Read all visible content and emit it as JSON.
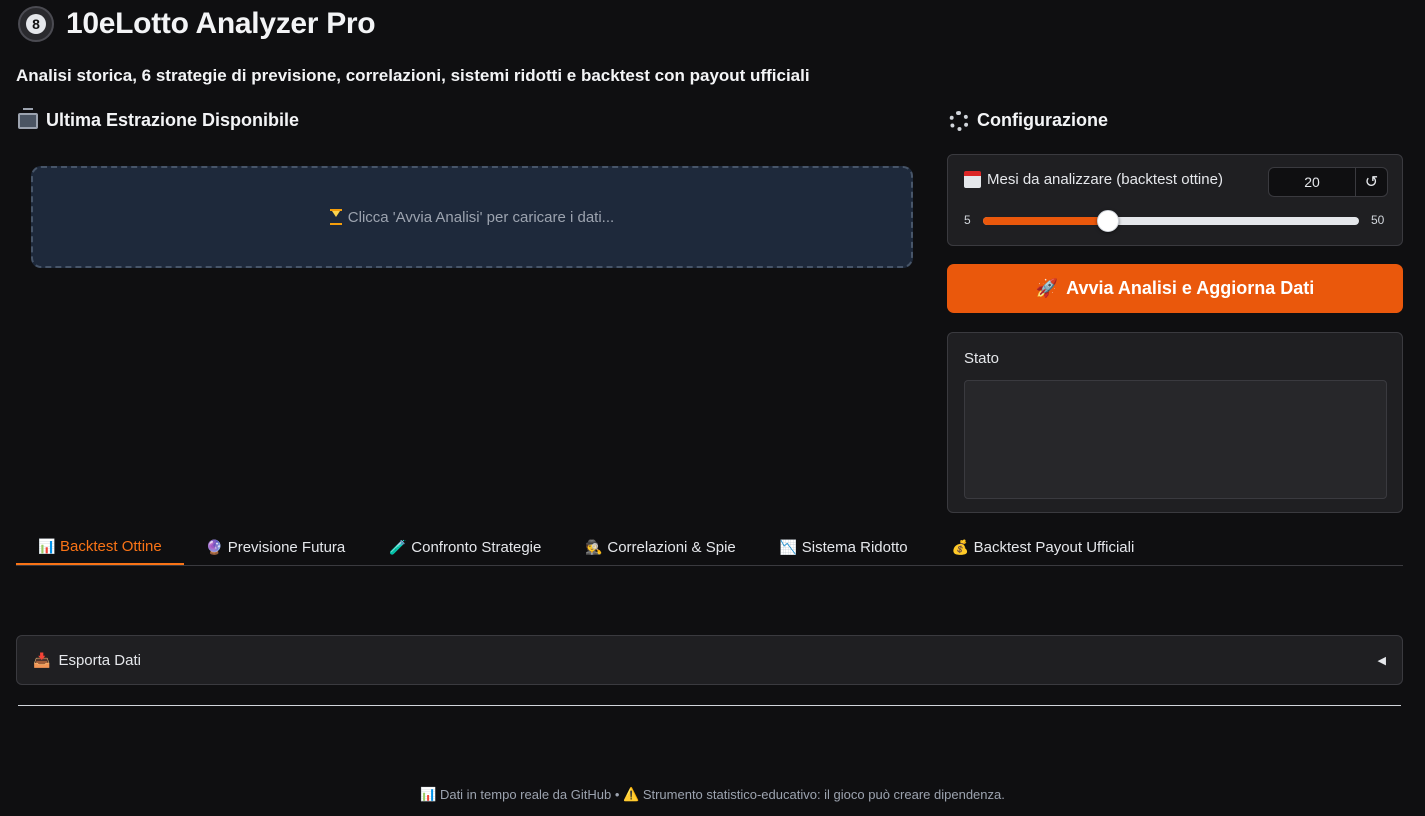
{
  "app": {
    "title": "10eLotto Analyzer Pro",
    "subtitle": "Analisi storica, 6 strategie di previsione, correlazioni, sistemi ridotti e backtest con payout ufficiali"
  },
  "left_section": {
    "heading": "Ultima Estrazione Disponibile",
    "placeholder": "Clicca 'Avvia Analisi' per caricare i dati..."
  },
  "config": {
    "heading": "Configurazione",
    "slider_label": "Mesi da analizzare (backtest ottine)",
    "value": "20",
    "min": "5",
    "max": "50",
    "value_fraction": 0.333,
    "reset_symbol": "↺"
  },
  "run_button": {
    "label": "Avvia Analisi e Aggiorna Dati"
  },
  "status": {
    "label": "Stato",
    "text": ""
  },
  "tabs": [
    {
      "label": "Backtest Ottine",
      "icon": "📊",
      "active": true
    },
    {
      "label": "Previsione Futura",
      "icon": "🔮",
      "active": false
    },
    {
      "label": "Confronto Strategie",
      "icon": "🧪",
      "active": false
    },
    {
      "label": "Correlazioni & Spie",
      "icon": "🕵",
      "active": false
    },
    {
      "label": "Sistema Ridotto",
      "icon": "📉",
      "active": false
    },
    {
      "label": "Backtest Payout Ufficiali",
      "icon": "💰",
      "active": false
    }
  ],
  "export": {
    "label": "Esporta Dati"
  },
  "footer": {
    "part1": "Dati in tempo reale da GitHub •",
    "part2": "Strumento statistico-educativo: il gioco può creare dipendenza."
  },
  "colors": {
    "accent": "#ea580c",
    "background": "#0f0f11"
  }
}
